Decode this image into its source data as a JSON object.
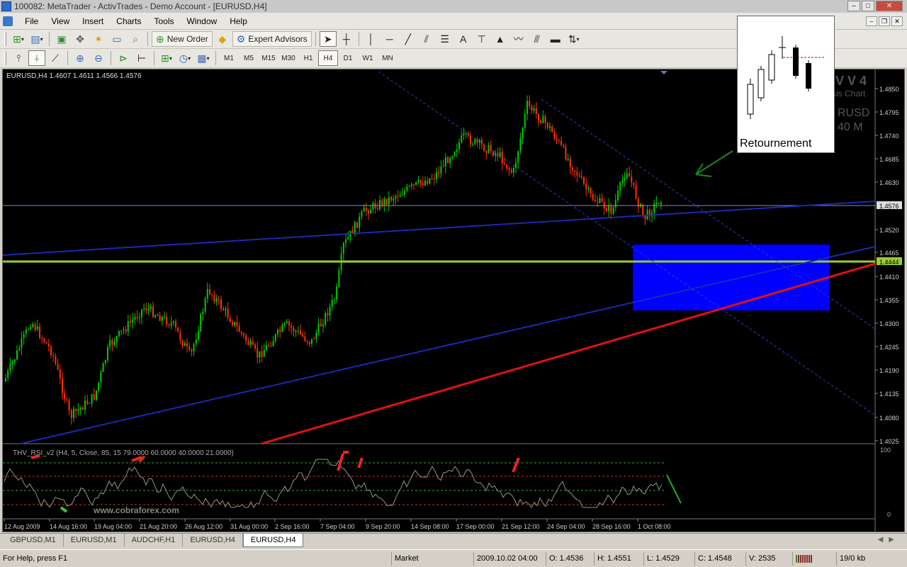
{
  "window": {
    "title": "100082: MetaTrader - ActivTrades - Demo Account - [EURUSD,H4]",
    "buttons": {
      "minimize": "‒",
      "maximize": "□",
      "close": "✕"
    }
  },
  "menu": {
    "items": [
      "File",
      "View",
      "Insert",
      "Charts",
      "Tools",
      "Window",
      "Help"
    ]
  },
  "toolbar": {
    "new_order": "New Order",
    "expert_advisors": "Expert Advisors",
    "timeframes": [
      "M1",
      "M5",
      "M15",
      "M30",
      "H1",
      "H4",
      "D1",
      "W1",
      "MN"
    ],
    "active_timeframe": "H4"
  },
  "chart": {
    "info": "EURUSD,H4  1.4607 1.4611 1.4566 1.4576",
    "watermark_lines": [
      "V V 4",
      "sis Chart",
      "RUSD",
      "40 M"
    ],
    "price_labels": [
      "1.4850",
      "1.4795",
      "1.4740",
      "1.4685",
      "1.4630",
      "1.4576",
      "1.4520",
      "1.4465",
      "1.4444",
      "1.4410",
      "1.4355",
      "1.4300",
      "1.4245",
      "1.4190",
      "1.4135",
      "1.4080",
      "1.4025"
    ],
    "current_price": "1.4576",
    "level_price": "1.4444",
    "time_labels": [
      "12 Aug 2009",
      "14 Aug 16:00",
      "19 Aug 04:00",
      "21 Aug 20:00",
      "26 Aug 12:00",
      "31 Aug 00:00",
      "2 Sep 16:00",
      "7 Sep 04:00",
      "9 Sep 20:00",
      "14 Sep 08:00",
      "17 Sep 00:00",
      "21 Sep 12:00",
      "24 Sep 04:00",
      "28 Sep 16:00",
      "1 Oct 08:00"
    ],
    "indicator_label": "THV_RSI_v2  (H4, 5, Close, 85, 15 79.0000 60.0000 40.0000 21.0000)",
    "indicator_scale": [
      "100",
      "0"
    ],
    "watermark_url": "www.cobraforex.com",
    "colors": {
      "bull": "#00cc00",
      "bear": "#ff3300",
      "trendline_blue": "#1a2ab0",
      "trendline_red": "#dd1111",
      "zone": "#0000ff",
      "level": "#99cc33"
    }
  },
  "inset": {
    "label": "Retournement"
  },
  "tabs": {
    "items": [
      "GBPUSD,M1",
      "EURUSD,M1",
      "AUDCHF,H1",
      "EURUSD,H4",
      "EURUSD,H4"
    ],
    "active_index": 4
  },
  "status": {
    "help": "For Help, press F1",
    "profile": "Market",
    "datetime": "2009.10.02 04:00",
    "open": "O: 1.4536",
    "high": "H: 1.4551",
    "low": "L: 1.4529",
    "close": "C: 1.4548",
    "volume": "V: 2535",
    "traffic": "19/0 kb"
  }
}
